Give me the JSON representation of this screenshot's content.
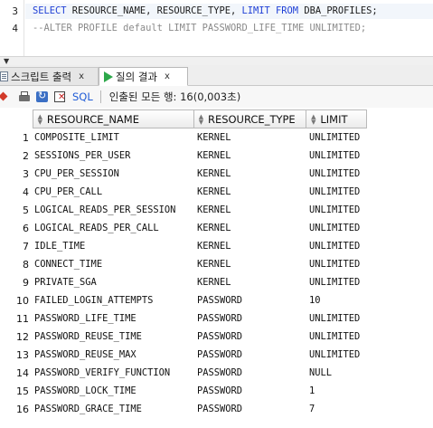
{
  "editor": {
    "lines": [
      {
        "number": "3",
        "kw1": "SELECT",
        "mid": " RESOURCE_NAME, RESOURCE_TYPE, ",
        "kw2": "LIMIT",
        "mid2": " ",
        "kw3": "FROM",
        "end": " DBA_PROFILES;"
      },
      {
        "number": "4",
        "comment": "--ALTER PROFILE default LIMIT PASSWORD_LIFE_TIME UNLIMITED;"
      }
    ]
  },
  "tabs": [
    {
      "label": "스크립트 출력",
      "close": "x",
      "icon": "script-icon"
    },
    {
      "label": "질의 결과",
      "close": "x",
      "icon": "play-icon"
    }
  ],
  "toolbar": {
    "sql_label": "SQL",
    "status": "인출된 모든 행: 16(0,003초)",
    "icons": [
      "pin-icon",
      "print-icon",
      "refresh-icon",
      "clear-icon"
    ]
  },
  "grid": {
    "columns": [
      "RESOURCE_NAME",
      "RESOURCE_TYPE",
      "LIMIT"
    ],
    "rows": [
      [
        "1",
        "COMPOSITE_LIMIT",
        "KERNEL",
        "UNLIMITED"
      ],
      [
        "2",
        "SESSIONS_PER_USER",
        "KERNEL",
        "UNLIMITED"
      ],
      [
        "3",
        "CPU_PER_SESSION",
        "KERNEL",
        "UNLIMITED"
      ],
      [
        "4",
        "CPU_PER_CALL",
        "KERNEL",
        "UNLIMITED"
      ],
      [
        "5",
        "LOGICAL_READS_PER_SESSION",
        "KERNEL",
        "UNLIMITED"
      ],
      [
        "6",
        "LOGICAL_READS_PER_CALL",
        "KERNEL",
        "UNLIMITED"
      ],
      [
        "7",
        "IDLE_TIME",
        "KERNEL",
        "UNLIMITED"
      ],
      [
        "8",
        "CONNECT_TIME",
        "KERNEL",
        "UNLIMITED"
      ],
      [
        "9",
        "PRIVATE_SGA",
        "KERNEL",
        "UNLIMITED"
      ],
      [
        "10",
        "FAILED_LOGIN_ATTEMPTS",
        "PASSWORD",
        "10"
      ],
      [
        "11",
        "PASSWORD_LIFE_TIME",
        "PASSWORD",
        "UNLIMITED"
      ],
      [
        "12",
        "PASSWORD_REUSE_TIME",
        "PASSWORD",
        "UNLIMITED"
      ],
      [
        "13",
        "PASSWORD_REUSE_MAX",
        "PASSWORD",
        "UNLIMITED"
      ],
      [
        "14",
        "PASSWORD_VERIFY_FUNCTION",
        "PASSWORD",
        "NULL"
      ],
      [
        "15",
        "PASSWORD_LOCK_TIME",
        "PASSWORD",
        "1"
      ],
      [
        "16",
        "PASSWORD_GRACE_TIME",
        "PASSWORD",
        "7"
      ]
    ]
  }
}
